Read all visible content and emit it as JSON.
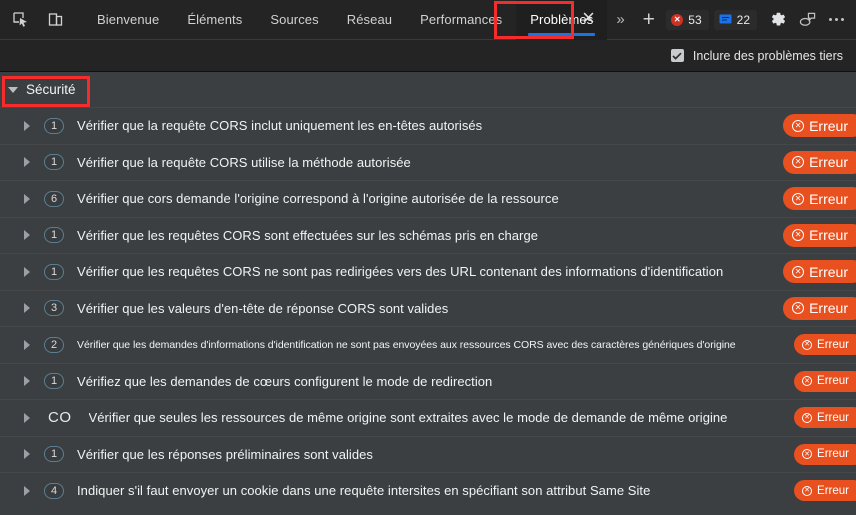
{
  "toolbar": {
    "inspect_icon": "inspect-element-icon",
    "device_icon": "device-toolbar-icon",
    "tabs": [
      {
        "label": "Bienvenue",
        "active": false
      },
      {
        "label": "Éléments",
        "active": false
      },
      {
        "label": "Sources",
        "active": false
      },
      {
        "label": "Réseau",
        "active": false
      },
      {
        "label": "Performances",
        "active": false
      },
      {
        "label": "Problèmes",
        "active": true
      }
    ],
    "more_tabs_label": "»",
    "add_tab_label": "+",
    "error_count": "53",
    "message_count": "22",
    "settings_icon": "gear-icon",
    "feedback_icon": "feedback-icon",
    "more_options_icon": "more-options-icon",
    "close_tab_icon": "close-icon"
  },
  "filter": {
    "third_party_label": "Inclure des problèmes tiers",
    "checked": true
  },
  "category": {
    "label": "Sécurité",
    "expanded": true
  },
  "issues": [
    {
      "count": "1",
      "title": "Vérifier que la requête CORS inclut uniquement les en-têtes autorisés",
      "severity": "Erreur",
      "condensed": false
    },
    {
      "count": "1",
      "title": "Vérifier que la requête CORS utilise la méthode autorisée",
      "severity": "Erreur",
      "condensed": false
    },
    {
      "count": "6",
      "title": "Vérifier que cors demande l'origine correspond à l'origine autorisée de la ressource",
      "severity": "Erreur",
      "condensed": false
    },
    {
      "count": "1",
      "title": "Vérifier que les requêtes CORS sont effectuées sur les schémas pris en charge",
      "severity": "Erreur",
      "condensed": false
    },
    {
      "count": "1",
      "title": "Vérifier que les requêtes CORS ne sont pas redirigées vers des URL contenant des informations d'identification",
      "severity": "Erreur",
      "condensed": false
    },
    {
      "count": "3",
      "title": "Vérifier que les valeurs d'en-tête de réponse CORS sont valides",
      "severity": "Erreur",
      "condensed": false
    },
    {
      "count": "2",
      "title": "Vérifier que les demandes d'informations d'identification ne sont pas envoyées aux ressources CORS avec des caractères génériques d'origine",
      "severity": "Erreur",
      "condensed": true
    },
    {
      "count": "1",
      "title": "Vérifiez que les demandes de cœurs configurent le mode de redirection",
      "severity": "Erreur",
      "condensed": false
    },
    {
      "count": "CO",
      "title": "Vérifier que seules les ressources de même origine sont extraites avec le mode de demande de même origine",
      "severity": "Erreur",
      "condensed": false
    },
    {
      "count": "1",
      "title": "Vérifier que les réponses préliminaires sont valides",
      "severity": "Erreur",
      "condensed": false
    },
    {
      "count": "4",
      "title": "Indiquer s'il faut envoyer un cookie dans une requête intersites en spécifiant son attribut Same Site",
      "severity": "Erreur",
      "condensed": false
    }
  ],
  "colors": {
    "error_pill": "#e8501f",
    "accent_tab": "#1a73e8",
    "annotation": "#f42c2c",
    "error_counter": "#cf3124",
    "message_counter": "#1a73e8",
    "count_badge_border": "#5b7f92"
  }
}
